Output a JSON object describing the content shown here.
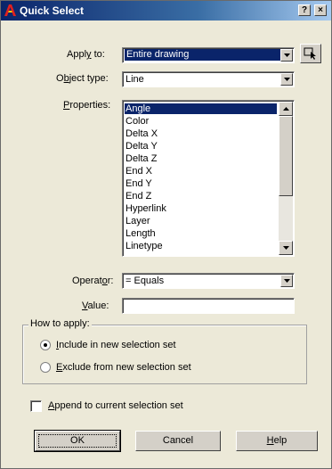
{
  "window": {
    "title": "Quick Select",
    "help_glyph": "?",
    "close_glyph": "×"
  },
  "apply_to": {
    "label_pre": "Appl",
    "label_u": "y",
    "label_post": " to:",
    "value": "Entire drawing"
  },
  "object_type": {
    "label_pre": "O",
    "label_u": "b",
    "label_post": "ject type:",
    "value": "Line"
  },
  "properties": {
    "label_pre": "",
    "label_u": "P",
    "label_post": "roperties:",
    "items": [
      "Angle",
      "Color",
      "Delta X",
      "Delta Y",
      "Delta Z",
      "End X",
      "End Y",
      "End Z",
      "Hyperlink",
      "Layer",
      "Length",
      "Linetype"
    ],
    "selected_index": 0
  },
  "operator": {
    "label_pre": "Operat",
    "label_u": "o",
    "label_post": "r:",
    "value": "= Equals"
  },
  "value_field": {
    "label_pre": "",
    "label_u": "V",
    "label_post": "alue:",
    "value": ""
  },
  "how_to_apply": {
    "title": "How to apply:",
    "include": {
      "pre": "",
      "u": "I",
      "post": "nclude in new selection set",
      "checked": true
    },
    "exclude": {
      "pre": "",
      "u": "E",
      "post": "xclude from new selection set",
      "checked": false
    }
  },
  "append": {
    "pre": "",
    "u": "A",
    "post": "ppend to current selection set",
    "checked": false
  },
  "buttons": {
    "ok": "OK",
    "cancel": "Cancel",
    "help_pre": "",
    "help_u": "H",
    "help_post": "elp"
  }
}
